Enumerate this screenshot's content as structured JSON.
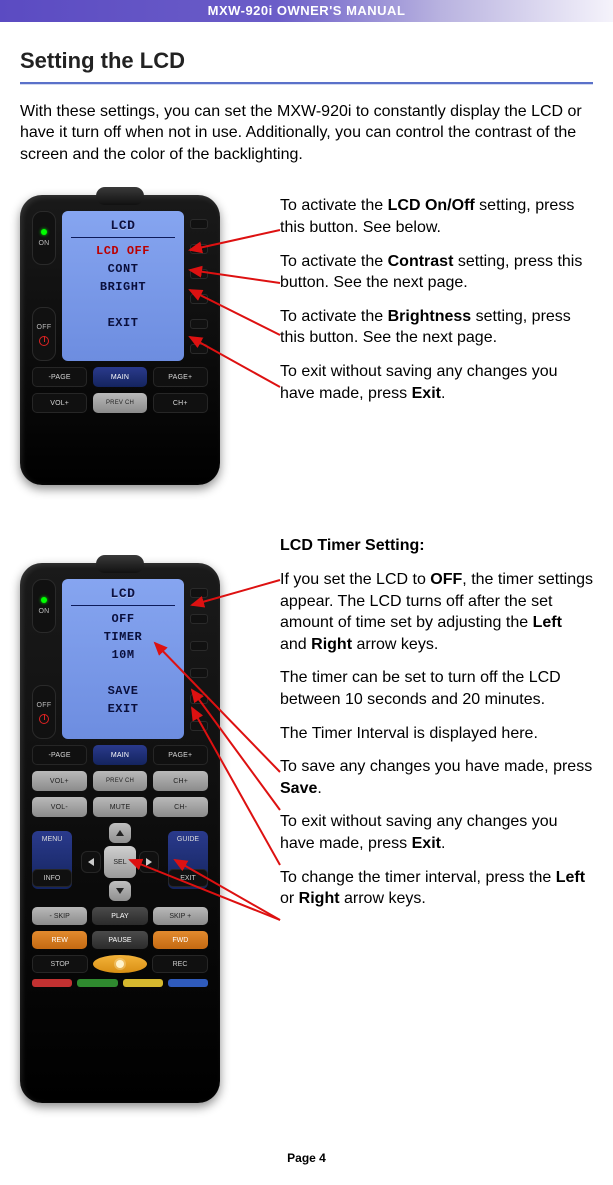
{
  "header": "MXW-920i OWNER'S MANUAL",
  "title": "Setting the LCD",
  "intro": "With these settings, you can set the MXW-920i to constantly display the LCD or have it turn off when not in use. Additionally, you can control the contrast of the screen and the color of the backlighting.",
  "footer": "Page 4",
  "section1": {
    "lcd": {
      "title": "LCD",
      "lines": [
        "LCD OFF",
        "CONT",
        "BRIGHT",
        "",
        "EXIT"
      ]
    },
    "callouts": [
      {
        "pre": "To activate the ",
        "bold": "LCD On/Off",
        "post": " setting, press this button. See below."
      },
      {
        "pre": "To activate the ",
        "bold": "Contrast",
        "post": " setting, press this button. See the next page."
      },
      {
        "pre": "To activate the ",
        "bold": "Brightness",
        "post": " setting, press this button. See the next page."
      },
      {
        "pre": "To exit without saving any changes you have made, press ",
        "bold": "Exit",
        "post": "."
      }
    ]
  },
  "section2": {
    "heading": "LCD Timer Setting:",
    "lcd": {
      "title": "LCD",
      "lines": [
        "OFF",
        "TIMER",
        "10M",
        "",
        "SAVE",
        "EXIT"
      ]
    },
    "callouts": [
      {
        "html": "If you set the LCD to <b>OFF</b>, the timer settings appear. The LCD turns off after the set amount of time set by adjusting the <b>Left</b> and <b>Right</b> arrow keys."
      },
      {
        "html": "The timer can be set to turn off the LCD between 10 seconds and 20 minutes."
      },
      {
        "html": "The Timer Interval is displayed here."
      },
      {
        "html": "To save any changes you have made, press <b>Save</b>."
      },
      {
        "html": "To exit without saving any changes you have made, press <b>Exit</b>."
      },
      {
        "html": "To change the timer interval, press the <b>Left</b> or <b>Right</b> arrow keys."
      }
    ]
  },
  "remoteLabels": {
    "on": "ON",
    "off": "OFF",
    "pageMinus": "-PAGE",
    "main": "MAIN",
    "pagePlus": "PAGE+",
    "volPlus": "VOL+",
    "prevCh": "PREV CH",
    "chPlus": "CH+",
    "volMinus": "VOL-",
    "mute": "MUTE",
    "chMinus": "CH-",
    "menu": "MENU",
    "guide": "GUIDE",
    "sel": "SEL",
    "info": "INFO",
    "exit": "EXIT",
    "skipMinus": "- SKIP",
    "play": "PLAY",
    "skipPlus": "SKIP +",
    "rew": "REW",
    "pause": "PAUSE",
    "fwd": "FWD",
    "stop": "STOP",
    "rec": "REC"
  },
  "colorKeys": [
    "#c23131",
    "#2f8a2f",
    "#d6b82e",
    "#2f5bbc"
  ]
}
